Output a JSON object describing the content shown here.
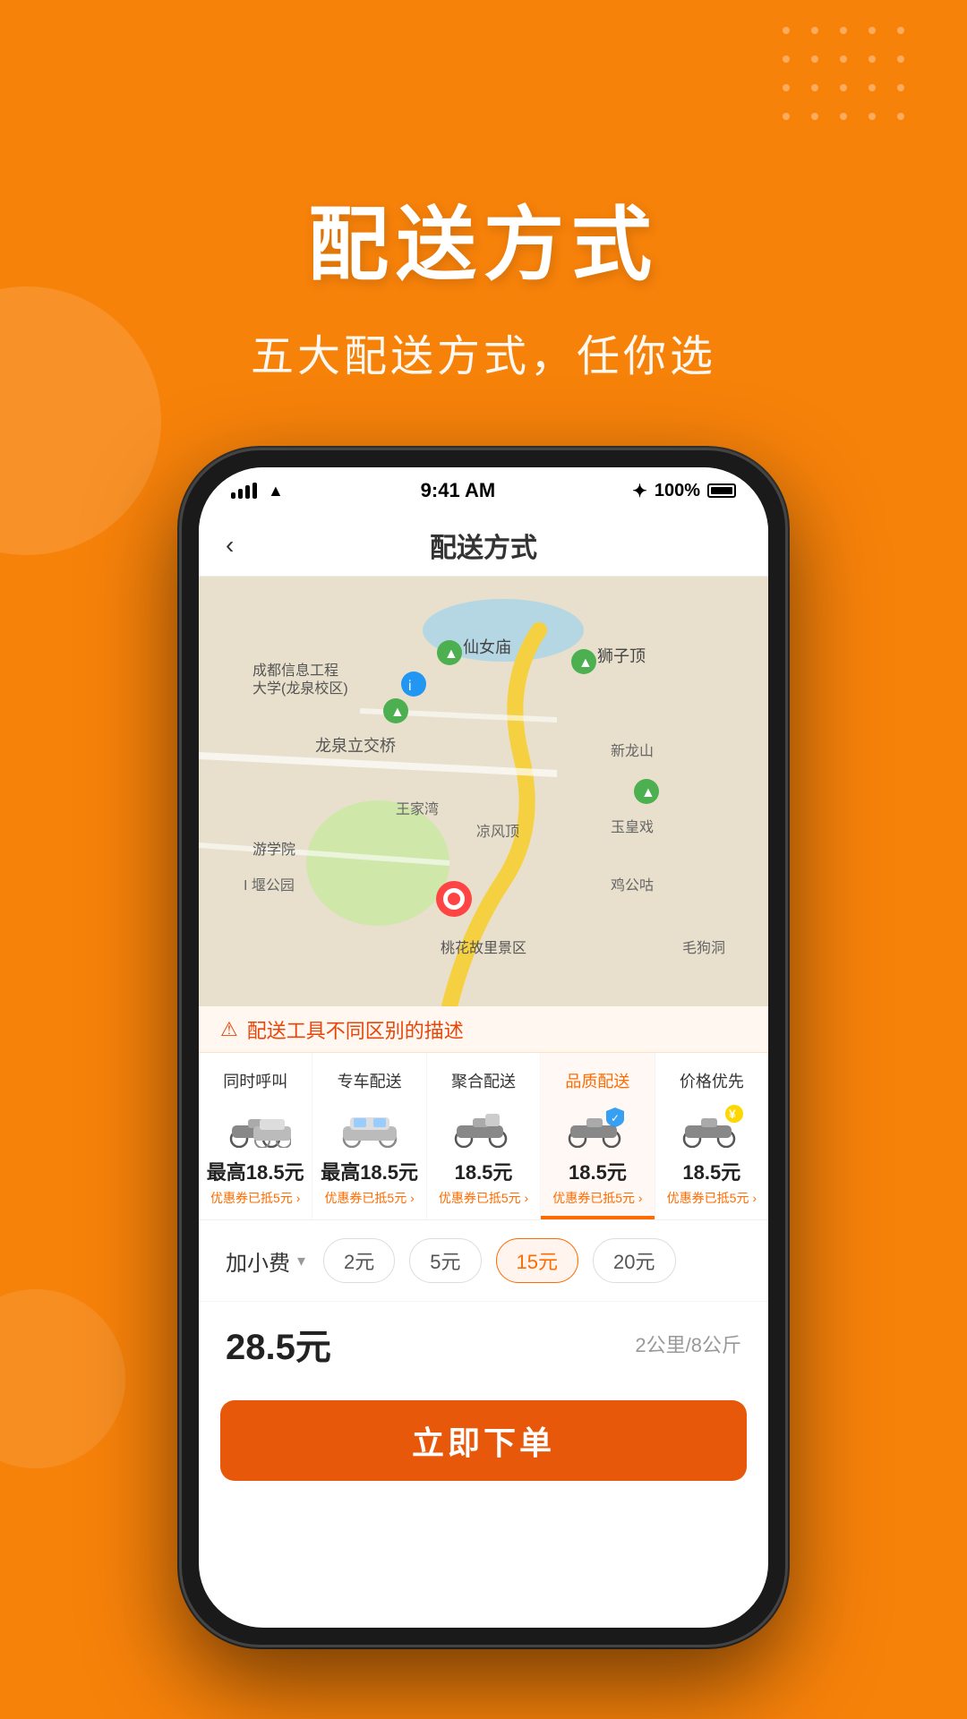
{
  "background_color": "#F7820A",
  "header": {
    "main_title": "配送方式",
    "sub_title": "五大配送方式，任你选"
  },
  "dot_grid": {
    "count": 20
  },
  "phone": {
    "status_bar": {
      "time": "9:41 AM",
      "battery": "100%"
    },
    "nav": {
      "back_label": "‹",
      "title": "配送方式"
    },
    "warning": {
      "icon": "●",
      "text": "配送工具不同区别的描述"
    },
    "delivery_tabs": [
      {
        "name": "同时呼叫",
        "price": "最高18.5元",
        "coupon": "优惠券已抵5元 ›",
        "icon_type": "moto+car",
        "active": false
      },
      {
        "name": "专车配送",
        "price": "最高18.5元",
        "coupon": "优惠券已抵5元 ›",
        "icon_type": "car",
        "active": false
      },
      {
        "name": "聚合配送",
        "price": "18.5元",
        "coupon": "优惠券已抵5元 ›",
        "icon_type": "moto",
        "active": false
      },
      {
        "name": "品质配送",
        "price": "18.5元",
        "coupon": "优惠券已抵5元 ›",
        "icon_type": "moto+shield",
        "active": true
      },
      {
        "name": "价格优先",
        "price": "18.5元",
        "coupon": "优惠券已抵5元 ›",
        "icon_type": "moto+bag",
        "active": false
      }
    ],
    "addon": {
      "label": "加小费",
      "pills": [
        "2元",
        "5元",
        "15元",
        "20元"
      ],
      "active_pill": "15元"
    },
    "total": {
      "price": "28.5元",
      "distance": "2公里/8公斤"
    },
    "order_button": {
      "label": "立即下单"
    }
  }
}
